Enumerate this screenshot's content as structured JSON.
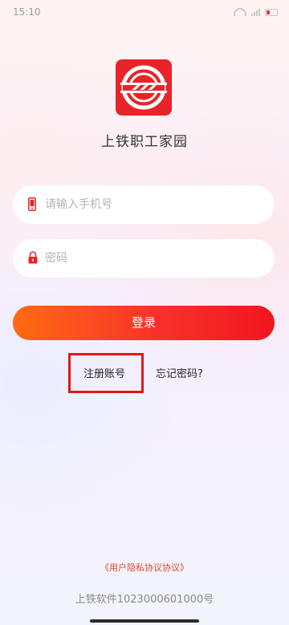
{
  "status_bar": {
    "time": "15:10"
  },
  "app": {
    "title": "上铁职工家园",
    "logo_icon": "railway-logo-icon",
    "logo_color": "#e8242a"
  },
  "phone_field": {
    "placeholder": "请输入手机号",
    "value": "",
    "icon": "phone-icon"
  },
  "password_field": {
    "placeholder": "密码",
    "value": "",
    "icon": "lock-icon"
  },
  "login_button": {
    "label": "登录",
    "gradient_start": "#ff6b12",
    "gradient_end": "#f0161f"
  },
  "links": {
    "register": "注册账号",
    "forgot_password": "忘记密码?"
  },
  "footer": {
    "privacy": "《用户隐私协议协议》",
    "license": "上铁软件1023000601000号"
  },
  "colors": {
    "accent": "#e8242a",
    "highlight_box": "#e01818",
    "privacy_link": "#e3462f"
  }
}
